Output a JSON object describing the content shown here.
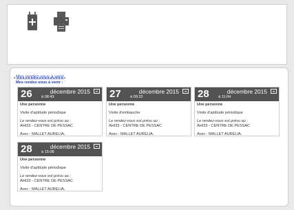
{
  "toolbar": {
    "icons": [
      "medical-kit-icon",
      "printer-icon"
    ]
  },
  "appointments": {
    "heading": "Mes rendez-vous à venir",
    "title": "Mes rendez-vous à venir :",
    "cards": [
      {
        "day": "26",
        "month_year": "décembre 2015",
        "time": "à 08:43",
        "person": "Une personne",
        "reason": "Visite d'aptitude périodique",
        "planned_label": "Le rendez-vous est prévu au :",
        "location": "AHI33 - CENTRE DE PESSAC",
        "with": "Avec : MALLET AURELIA."
      },
      {
        "day": "27",
        "month_year": "décembre 2015",
        "time": "à 09:22",
        "person": "Une personne",
        "reason": "Visite d'embauche",
        "planned_label": "Le rendez-vous est prévu au :",
        "location": "AHI33 - CENTRE DE PESSAC",
        "with": "Avec : MALLET AURELIA."
      },
      {
        "day": "28",
        "month_year": "décembre 2015",
        "time": "à 11:04",
        "person": "Une personne",
        "reason": "Visite d'aptitude périodique",
        "planned_label": "Le rendez-vous est prévu au :",
        "location": "AHI33 - CENTRE DE PESSAC",
        "with": "Avec : MALLET AURELIA."
      },
      {
        "day": "28",
        "month_year": "décembre 2015",
        "time": "à 15:08",
        "person": "Une personne",
        "reason": "Visite d'aptitude périodique",
        "planned_label": "Le rendez-vous est prévu au :",
        "location": "AHI33 - CENTRE DE PESSAC",
        "with": "Avec : MALLET AURELIA."
      }
    ]
  },
  "colors": {
    "card_header": "#525252",
    "title_blue": "#1f3da6"
  }
}
